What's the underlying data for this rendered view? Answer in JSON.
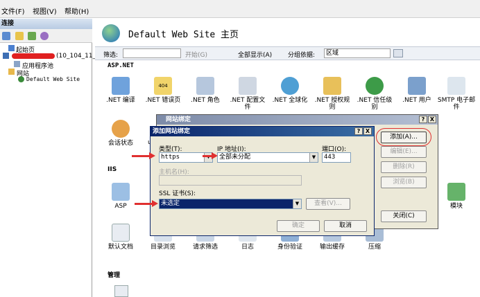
{
  "menu": {
    "file": "文件(F)",
    "view": "视图(V)",
    "help": "帮助(H)"
  },
  "connections": {
    "header": "连接",
    "tree": {
      "start": "起始页",
      "server_suffix": "(10_104_11_",
      "app_pools": "应用程序池",
      "sites": "网站",
      "default_site": "Default Web Site"
    }
  },
  "main": {
    "title": "Default Web Site 主页",
    "filter": {
      "label": "筛选:",
      "start": "开始(G)",
      "show_all": "全部显示(A)",
      "group_by": "分组依据:",
      "group_value": "区域"
    },
    "groups": {
      "aspnet": "ASP.NET",
      "iis": "IIS",
      "manage": "管理"
    },
    "aspnet_features": [
      ".NET 编译",
      ".NET 错误页",
      ".NET 角色",
      ".NET 配置文件",
      ".NET 全球化",
      ".NET 授权规则",
      ".NET 信任级别",
      ".NET 用户",
      "SMTP 电子邮件"
    ],
    "session_state": "会话状态",
    "partial_label": "u",
    "iis_features": {
      "asp": "ASP",
      "modules": "模块",
      "default_doc": "默认文档",
      "dir_browse": "目录浏览",
      "req_filter": "请求筛选",
      "logging": "日志",
      "auth": "身份验证",
      "output_cache": "输出缓存",
      "compression": "压缩"
    },
    "badge_404": "404"
  },
  "site_bindings": {
    "title": "网站绑定",
    "help": "?",
    "close": "X",
    "buttons": {
      "add": "添加(A)...",
      "edit": "编辑(E)...",
      "remove": "删除(R)",
      "browse": "浏览(B)",
      "close": "关闭(C)"
    }
  },
  "add_binding": {
    "title": "添加网站绑定",
    "help": "?",
    "close": "X",
    "type_label": "类型(T):",
    "type_value": "https",
    "ip_label": "IP 地址(I):",
    "ip_value": "全部未分配",
    "port_label": "端口(O):",
    "port_value": "443",
    "host_label": "主机名(H):",
    "ssl_label": "SSL 证书(S):",
    "ssl_value": "未选定",
    "view_button": "查看(V)...",
    "ok": "确定",
    "cancel": "取消"
  },
  "colors": {
    "annotation_red": "#e03030",
    "titlebar_blue": "#0a246a",
    "selection_blue": "#0a246a"
  }
}
